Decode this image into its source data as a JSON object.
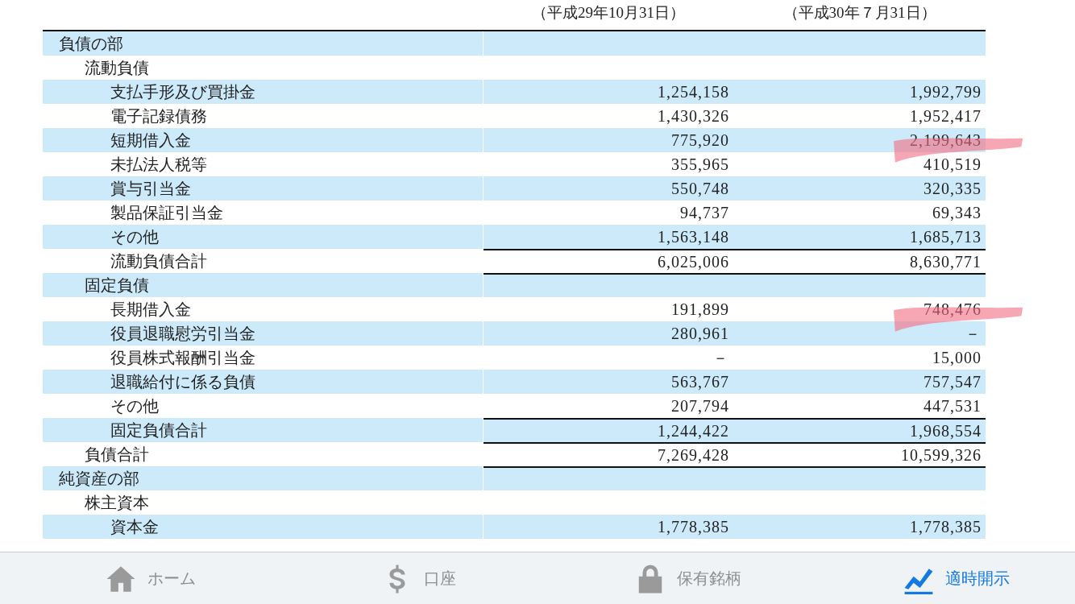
{
  "table": {
    "columns": [
      "（平成29年10月31日）",
      "（平成30年７月31日）"
    ],
    "rows": [
      {
        "label": "負債の部",
        "children": [
          {
            "label": "流動負債",
            "children": [
              {
                "label": "支払手形及び買掛金",
                "values": [
                  "1,254,158",
                  "1,992,799"
                ]
              },
              {
                "label": "電子記録債務",
                "values": [
                  "1,430,326",
                  "1,952,417"
                ]
              },
              {
                "label": "短期借入金",
                "values": [
                  "775,920",
                  "2,199,643"
                ],
                "highlighted": true
              },
              {
                "label": "未払法人税等",
                "values": [
                  "355,965",
                  "410,519"
                ]
              },
              {
                "label": "賞与引当金",
                "values": [
                  "550,748",
                  "320,335"
                ]
              },
              {
                "label": "製品保証引当金",
                "values": [
                  "94,737",
                  "69,343"
                ]
              },
              {
                "label": "その他",
                "values": [
                  "1,563,148",
                  "1,685,713"
                ]
              },
              {
                "label": "流動負債合計",
                "values": [
                  "6,025,006",
                  "8,630,771"
                ],
                "rule_above": true
              }
            ]
          },
          {
            "label": "固定負債",
            "rule_above": true,
            "children": [
              {
                "label": "長期借入金",
                "values": [
                  "191,899",
                  "748,476"
                ],
                "highlighted": true
              },
              {
                "label": "役員退職慰労引当金",
                "values": [
                  "280,961",
                  "－"
                ]
              },
              {
                "label": "役員株式報酬引当金",
                "values": [
                  "－",
                  "15,000"
                ]
              },
              {
                "label": "退職給付に係る負債",
                "values": [
                  "563,767",
                  "757,547"
                ]
              },
              {
                "label": "その他",
                "values": [
                  "207,794",
                  "447,531"
                ]
              },
              {
                "label": "固定負債合計",
                "values": [
                  "1,244,422",
                  "1,968,554"
                ],
                "rule_above": true
              }
            ]
          },
          {
            "label": "負債合計",
            "values": [
              "7,269,428",
              "10,599,326"
            ],
            "rule_above": true
          }
        ]
      },
      {
        "label": "純資産の部",
        "rule_above": true,
        "children": [
          {
            "label": "株主資本",
            "children": [
              {
                "label": "資本金",
                "values": [
                  "1,778,385",
                  "1,778,385"
                ]
              }
            ]
          }
        ]
      }
    ]
  },
  "tab_bar": [
    {
      "label": "ホーム",
      "selected": false
    },
    {
      "label": "口座",
      "selected": false
    },
    {
      "label": "保有銘柄",
      "selected": false
    },
    {
      "label": "適時開示",
      "selected": true
    }
  ]
}
